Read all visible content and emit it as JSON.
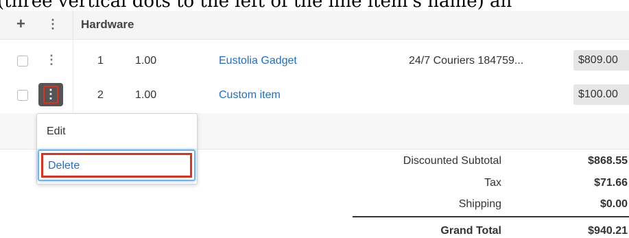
{
  "caption": "(three vertical dots to the left of the line item's name) an",
  "header": {
    "add_glyph": "+",
    "menu_glyph": "⋮",
    "title": "Hardware"
  },
  "rows": [
    {
      "index": "1",
      "quantity": "1.00",
      "name": "Eustolia Gadget",
      "description": "24/7 Couriers 184759...",
      "price": "$809.00"
    },
    {
      "index": "2",
      "quantity": "1.00",
      "name": "Custom item",
      "description": "",
      "price": "$100.00"
    }
  ],
  "action_menu": {
    "items": [
      "Edit",
      "Delete"
    ],
    "highlighted": "Delete"
  },
  "totals": {
    "discounted_subtotal_label": "Discounted Subtotal",
    "discounted_subtotal": "$868.55",
    "tax_label": "Tax",
    "tax": "$71.66",
    "shipping_label": "Shipping",
    "shipping": "$0.00",
    "grand_total_label": "Grand Total",
    "grand_total": "$940.21"
  },
  "colors": {
    "link": "#1f6fc5",
    "highlight_outline": "#e0301e",
    "focus_ring": "#6fb3f2"
  }
}
